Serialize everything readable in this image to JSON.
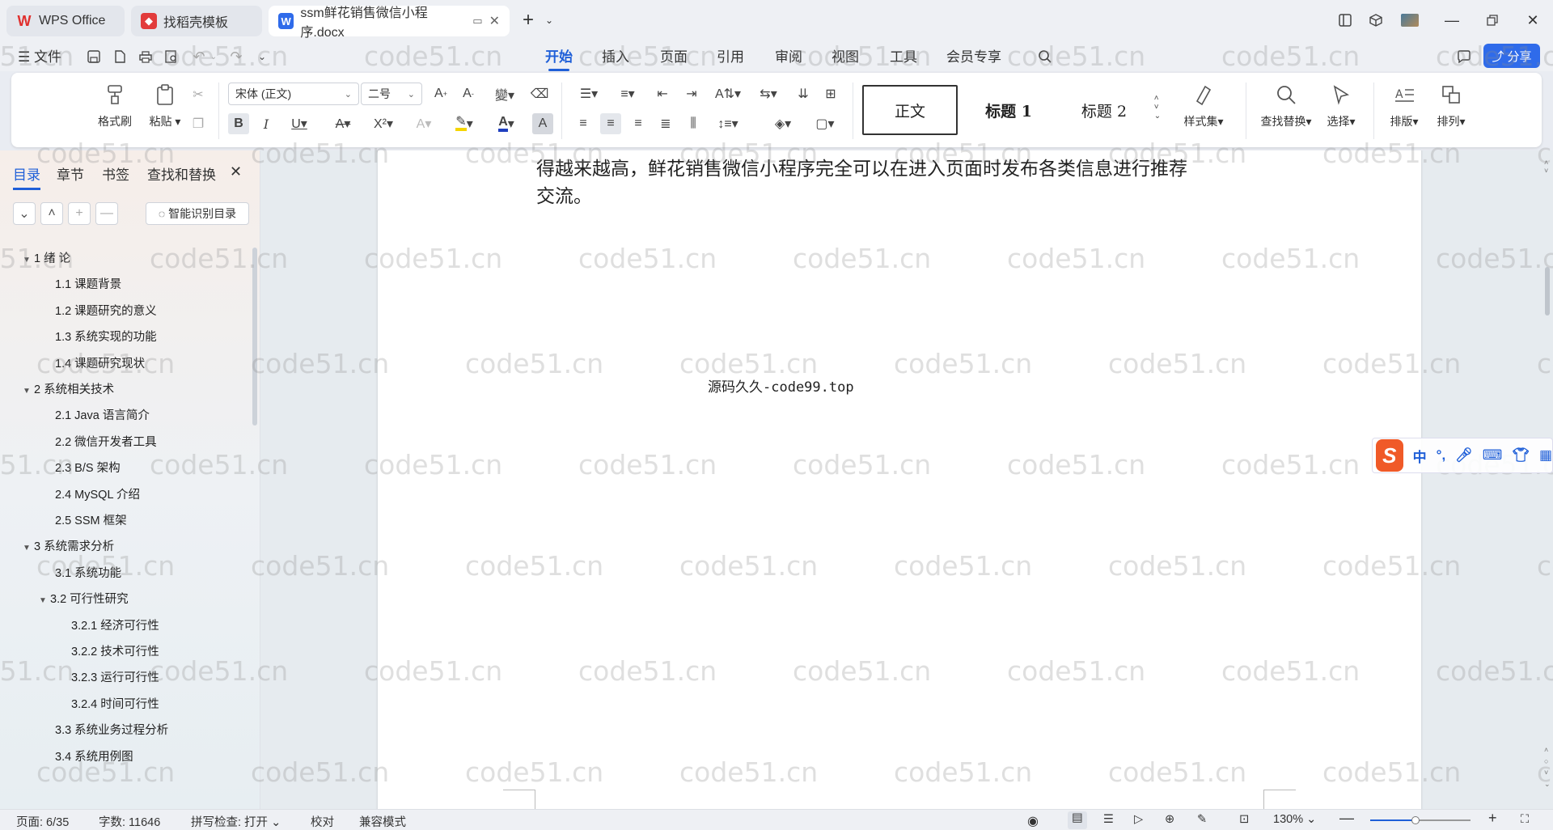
{
  "titlebar": {
    "tabs": [
      {
        "label": "WPS Office",
        "icon": "wps-logo-icon"
      },
      {
        "label": "找稻壳模板",
        "icon": "docer-icon"
      },
      {
        "label": "ssm鲜花销售微信小程序.docx",
        "icon": "word-doc-icon",
        "active": true
      }
    ],
    "new_tab": "+"
  },
  "menubar": {
    "file_label": "文件",
    "tabs": [
      "开始",
      "插入",
      "页面",
      "引用",
      "审阅",
      "视图",
      "工具",
      "会员专享"
    ],
    "active_tab": "开始",
    "share_label": "分享"
  },
  "ribbon": {
    "format_painter": "格式刷",
    "paste": "粘贴",
    "font_name": "宋体 (正文)",
    "font_size": "二号",
    "styles": {
      "normal": "正文",
      "heading1": "标题 1",
      "heading2": "标题 2"
    },
    "style_set": "样式集",
    "find_replace": "查找替换",
    "select": "选择",
    "layout": "排版",
    "arrange": "排列",
    "accent_color": "#1f5fd8",
    "font_color": "#1f3fbf",
    "highlight_color": "#f5d500"
  },
  "left_panel": {
    "tabs": [
      "目录",
      "章节",
      "书签",
      "查找和替换"
    ],
    "active_tab": "目录",
    "smart_toc_label": "智能识别目录",
    "toc": [
      {
        "label": "1  绪  论",
        "level": 1,
        "expanded": true
      },
      {
        "label": "1.1  课题背景",
        "level": 2
      },
      {
        "label": "1.2  课题研究的意义",
        "level": 2
      },
      {
        "label": "1.3  系统实现的功能",
        "level": 2
      },
      {
        "label": "1.4  课题研究现状",
        "level": 2
      },
      {
        "label": "2 系统相关技术",
        "level": 1,
        "expanded": true
      },
      {
        "label": "2.1 Java 语言简介",
        "level": 2
      },
      {
        "label": "2.2 微信开发者工具",
        "level": 2
      },
      {
        "label": "2.3 B/S 架构",
        "level": 2
      },
      {
        "label": "2.4 MySQL  介绍",
        "level": 2
      },
      {
        "label": "2.5 SSM 框架",
        "level": 2
      },
      {
        "label": "3 系统需求分析",
        "level": 1,
        "expanded": true
      },
      {
        "label": "3.1 系统功能",
        "level": 2
      },
      {
        "label": "3.2 可行性研究",
        "level": 2,
        "expanded": true
      },
      {
        "label": "3.2.1  经济可行性",
        "level": 3
      },
      {
        "label": "3.2.2  技术可行性",
        "level": 3
      },
      {
        "label": "3.2.3  运行可行性",
        "level": 3
      },
      {
        "label": "3.2.4  时间可行性",
        "level": 3
      },
      {
        "label": "3.3 系统业务过程分析",
        "level": 2
      },
      {
        "label": "3.4 系统用例图",
        "level": 2
      }
    ]
  },
  "document": {
    "paragraph_line1": "得越来越高，鲜花销售微信小程序完全可以在进入页面时发布各类信息进行推荐",
    "paragraph_line2": "交流。",
    "center_text": "源码久久-code99.top",
    "watermark": "code51.cn"
  },
  "ime": {
    "items": [
      "中",
      "°,",
      "mic",
      "keyboard",
      "shirt",
      "grid"
    ]
  },
  "statusbar": {
    "page": "页面: 6/35",
    "word_count": "字数: 11646",
    "spell_check": "拼写检查: 打开",
    "proofread": "校对",
    "compat_mode": "兼容模式",
    "zoom": "130%",
    "zoom_fraction": 0.45
  }
}
